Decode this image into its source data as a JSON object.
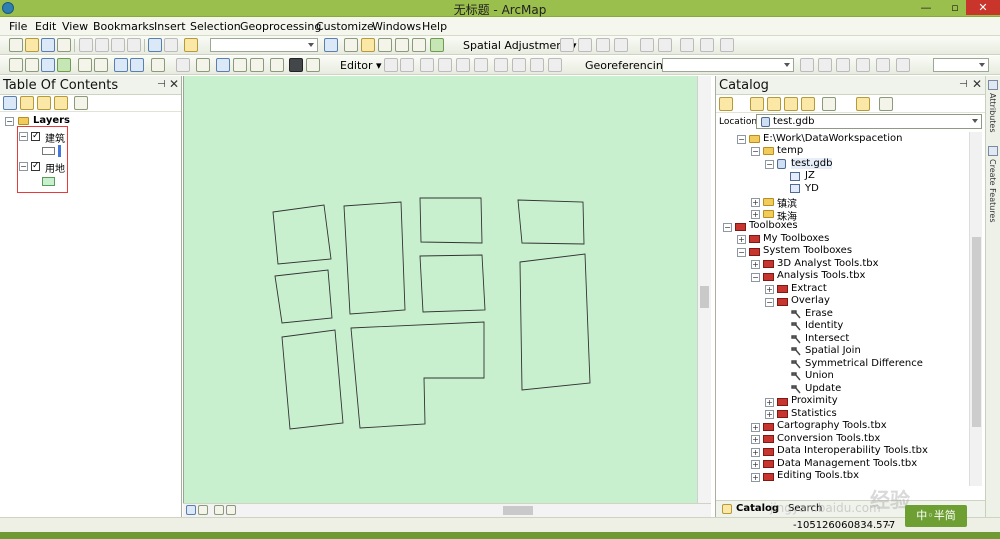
{
  "window": {
    "title": "无标题 - ArcMap",
    "min": "—",
    "max": "▫",
    "close": "✕"
  },
  "menu": [
    "File",
    "Edit",
    "View",
    "Bookmarks",
    "Insert",
    "Selection",
    "Geoprocessing",
    "Customize",
    "Windows",
    "Help"
  ],
  "toolbar": {
    "spatial_adjustment": "Spatial Adjustment ▾",
    "editor": "Editor ▾",
    "georeferencing": "Georeferencing ▾"
  },
  "toc": {
    "title": "Table Of Contents",
    "root": "Layers",
    "layers": [
      {
        "name": "建筑",
        "checked": "✓",
        "symbol_fill": "#ffffff",
        "symbol_stroke": "#777777",
        "accent": "#4477dd"
      },
      {
        "name": "用地",
        "checked": "✓",
        "symbol_fill": "#c8f0ce",
        "symbol_stroke": "#5a9a5a"
      }
    ],
    "pin": "⊣",
    "close": "✕"
  },
  "catalog": {
    "title": "Catalog",
    "location_label": "Location:",
    "location_value": "test.gdb",
    "pin": "⊣",
    "close": "✕",
    "tree": {
      "workspace": "E:\\Work\\DataWorkspacetion",
      "temp": "temp",
      "gdb": "test.gdb",
      "jz": "JZ",
      "yd": "YD",
      "f1": "镇滨",
      "f2": "珠海",
      "toolboxes": "Toolboxes",
      "my_toolboxes": "My Toolboxes",
      "system_toolboxes": "System Toolboxes",
      "analyst_3d": "3D Analyst Tools.tbx",
      "analysis": "Analysis Tools.tbx",
      "extract": "Extract",
      "overlay": "Overlay",
      "tools": [
        "Erase",
        "Identity",
        "Intersect",
        "Spatial Join",
        "Symmetrical Difference",
        "Union",
        "Update"
      ],
      "proximity": "Proximity",
      "statistics": "Statistics",
      "cartography": "Cartography Tools.tbx",
      "conversion": "Conversion Tools.tbx",
      "interop": "Data Interoperability Tools.tbx",
      "management": "Data Management Tools.tbx",
      "editing": "Editing Tools.tbx"
    },
    "tabs": [
      "Catalog",
      "Search"
    ]
  },
  "side_tabs": [
    "Attributes",
    "Create Features"
  ],
  "status": {
    "x": "-105126060834.577",
    "y": "-"
  },
  "watermark": {
    "badge": "中◦半简",
    "text": "经验",
    "url": "jingyan.baidu.com"
  },
  "colors": {
    "map_bg": "#c8f0ce",
    "title_bar": "#9bbf4c",
    "highlight_box": "#e53b3b"
  }
}
